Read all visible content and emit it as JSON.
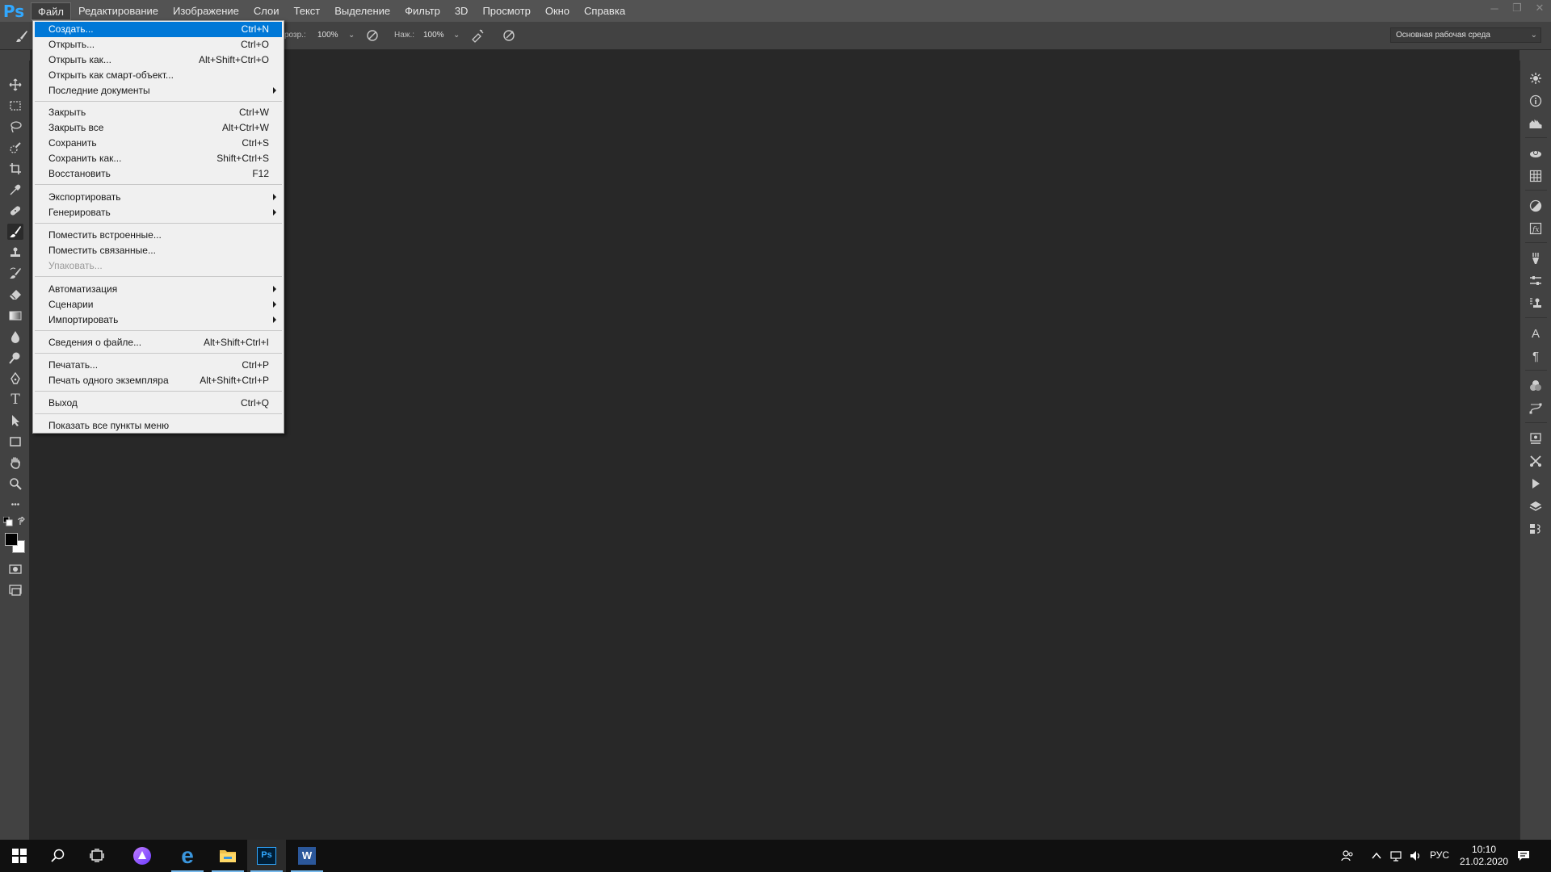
{
  "app": {
    "logo": "Ps"
  },
  "menubar": {
    "items": [
      {
        "label": "Файл"
      },
      {
        "label": "Редактирование"
      },
      {
        "label": "Изображение"
      },
      {
        "label": "Слои"
      },
      {
        "label": "Текст"
      },
      {
        "label": "Выделение"
      },
      {
        "label": "Фильтр"
      },
      {
        "label": "3D"
      },
      {
        "label": "Просмотр"
      },
      {
        "label": "Окно"
      },
      {
        "label": "Справка"
      }
    ],
    "window_controls": {
      "minimize": "─",
      "restore": "❐",
      "close": "✕"
    }
  },
  "options": {
    "opacity_label": "розр.:",
    "opacity_value": "100%",
    "flow_label": "Наж.:",
    "flow_value": "100%",
    "workspace": "Основная рабочая среда",
    "chevron": "⌄"
  },
  "file_menu": {
    "items": [
      {
        "label": "Создать...",
        "shortcut": "Ctrl+N",
        "highlight": true
      },
      {
        "label": "Открыть...",
        "shortcut": "Ctrl+O"
      },
      {
        "label": "Открыть как...",
        "shortcut": "Alt+Shift+Ctrl+O"
      },
      {
        "label": "Открыть как смарт-объект...",
        "shortcut": ""
      },
      {
        "label": "Последние документы",
        "shortcut": "",
        "submenu": true
      },
      {
        "label": "Закрыть",
        "shortcut": "Ctrl+W"
      },
      {
        "label": "Закрыть все",
        "shortcut": "Alt+Ctrl+W"
      },
      {
        "label": "Сохранить",
        "shortcut": "Ctrl+S"
      },
      {
        "label": "Сохранить как...",
        "shortcut": "Shift+Ctrl+S"
      },
      {
        "label": "Восстановить",
        "shortcut": "F12"
      },
      {
        "label": "Экспортировать",
        "shortcut": "",
        "submenu": true
      },
      {
        "label": "Генерировать",
        "shortcut": "",
        "submenu": true
      },
      {
        "label": "Поместить встроенные...",
        "shortcut": ""
      },
      {
        "label": "Поместить связанные...",
        "shortcut": ""
      },
      {
        "label": "Упаковать...",
        "shortcut": "",
        "disabled": true
      },
      {
        "label": "Автоматизация",
        "shortcut": "",
        "submenu": true
      },
      {
        "label": "Сценарии",
        "shortcut": "",
        "submenu": true
      },
      {
        "label": "Импортировать",
        "shortcut": "",
        "submenu": true
      },
      {
        "label": "Сведения о файле...",
        "shortcut": "Alt+Shift+Ctrl+I"
      },
      {
        "label": "Печатать...",
        "shortcut": "Ctrl+P"
      },
      {
        "label": "Печать одного экземпляра",
        "shortcut": "Alt+Shift+Ctrl+P"
      },
      {
        "label": "Выход",
        "shortcut": "Ctrl+Q"
      },
      {
        "label": "Показать все пункты меню",
        "shortcut": ""
      }
    ]
  },
  "toolbar": {
    "tools": [
      "move-icon",
      "marquee-icon",
      "lasso-icon",
      "quick-select-icon",
      "crop-icon",
      "eyedropper-icon",
      "healing-brush-icon",
      "brush-icon",
      "clone-stamp-icon",
      "history-brush-icon",
      "eraser-icon",
      "gradient-icon",
      "blur-icon",
      "dodge-icon",
      "pen-icon",
      "type-icon",
      "path-select-icon",
      "rectangle-icon",
      "hand-icon",
      "zoom-icon",
      "more-tools-icon"
    ],
    "type_glyph": "T",
    "more_glyph": "•••",
    "selected": "brush-icon"
  },
  "right_panel": {
    "icons": [
      "color-icon",
      "info-icon",
      "histogram-icon",
      "3d-icon",
      "grid-icon",
      "adjustments-icon",
      "styles-icon",
      "brush-settings-icon",
      "properties-icon",
      "clone-source-icon",
      "character-icon",
      "paragraph-icon",
      "channels-icon",
      "paths-icon",
      "glyphs-icon",
      "tool-presets-icon",
      "actions-icon",
      "layers-icon",
      "layer-comps-icon"
    ],
    "character_glyph": "A",
    "paragraph_glyph": "¶"
  },
  "taskbar": {
    "apps": [
      "start-icon",
      "search-icon",
      "task-view-icon",
      "alice-icon",
      "edge-icon",
      "explorer-icon",
      "photoshop-icon",
      "word-icon"
    ],
    "ps_label": "Ps",
    "word_label": "W",
    "edge_label": "e",
    "tray": {
      "language": "РУС",
      "time": "10:10",
      "date": "21.02.2020"
    }
  }
}
